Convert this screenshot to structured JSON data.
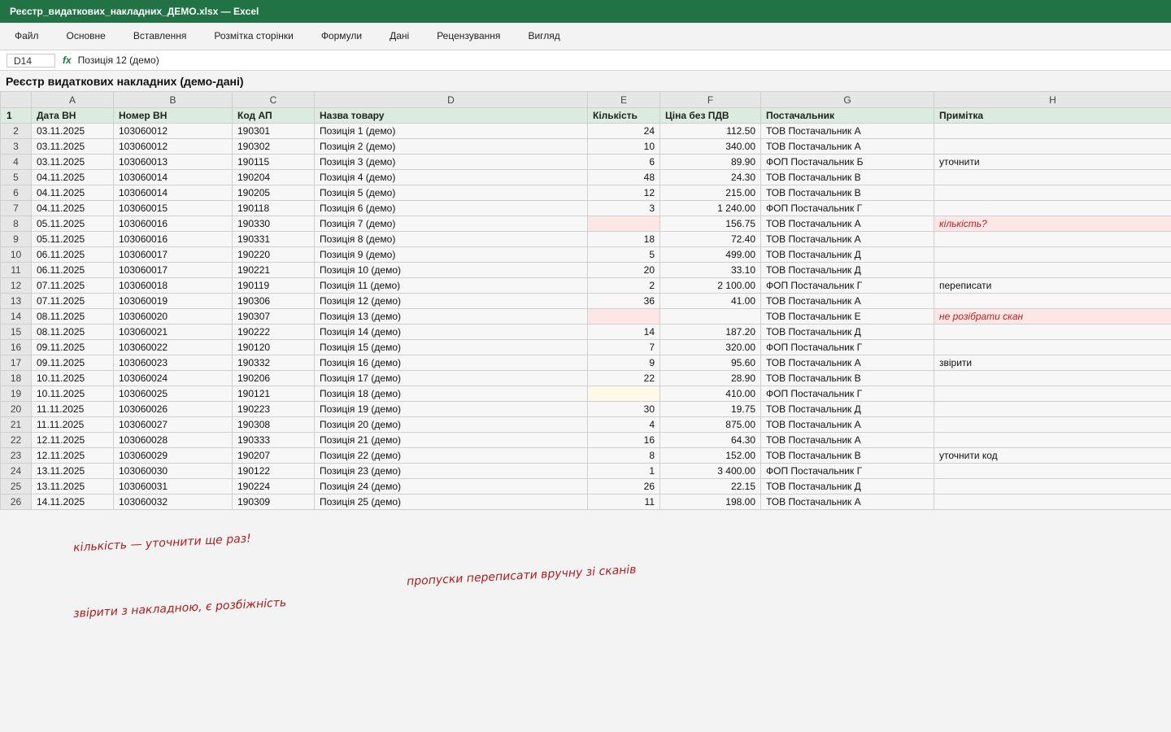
{
  "window": {
    "title": "Реєстр_видаткових_накладних_ДЕМО.xlsx — Excel"
  },
  "menu": [
    "Файл",
    "Основне",
    "Вставлення",
    "Розмітка сторінки",
    "Формули",
    "Дані",
    "Рецензування",
    "Вигляд"
  ],
  "formula_bar": {
    "cell_ref": "D14",
    "fx": "fx",
    "content": "Позиція 12 (демо)"
  },
  "sheet_title": "Реєстр видаткових накладних (демо-дані)",
  "columns": [
    "A",
    "B",
    "C",
    "D",
    "E",
    "F",
    "G",
    "H"
  ],
  "header": {
    "row_num": "1",
    "cells": [
      "Дата ВН",
      "Номер ВН",
      "Код АП",
      "Назва товару",
      "Кількість",
      "Ціна без ПДВ",
      "Постачальник",
      "Примітка"
    ]
  },
  "rows": [
    {
      "n": "2",
      "date": "03.11.2025",
      "doc": "103060012",
      "code": "190301",
      "name": "Позиція 1 (демо)",
      "qty": "24",
      "price": "112.50",
      "supplier": "ТОВ Постачальник А",
      "note": ""
    },
    {
      "n": "3",
      "date": "03.11.2025",
      "doc": "103060012",
      "code": "190302",
      "name": "Позиція 2 (демо)",
      "qty": "10",
      "price": "340.00",
      "supplier": "ТОВ Постачальник А",
      "note": ""
    },
    {
      "n": "4",
      "date": "03.11.2025",
      "doc": "103060013",
      "code": "190115",
      "name": "Позиція 3 (демо)",
      "qty": "6",
      "price": "89.90",
      "supplier": "ФОП Постачальник Б",
      "note": "уточнити"
    },
    {
      "n": "5",
      "date": "04.11.2025",
      "doc": "103060014",
      "code": "190204",
      "name": "Позиція 4 (демо)",
      "qty": "48",
      "price": "24.30",
      "supplier": "ТОВ Постачальник В",
      "note": ""
    },
    {
      "n": "6",
      "date": "04.11.2025",
      "doc": "103060014",
      "code": "190205",
      "name": "Позиція 5 (демо)",
      "qty": "12",
      "price": "215.00",
      "supplier": "ТОВ Постачальник В",
      "note": ""
    },
    {
      "n": "7",
      "date": "04.11.2025",
      "doc": "103060015",
      "code": "190118",
      "name": "Позиція 6 (демо)",
      "qty": "3",
      "price": "1 240.00",
      "supplier": "ФОП Постачальник Г",
      "note": ""
    },
    {
      "n": "8",
      "date": "05.11.2025",
      "doc": "103060016",
      "code": "190330",
      "name": "Позиція 7 (демо)",
      "qty": "",
      "price": "156.75",
      "supplier": "ТОВ Постачальник А",
      "note": "кількість?",
      "qty_flag": "missing",
      "note_flag": "alert"
    },
    {
      "n": "9",
      "date": "05.11.2025",
      "doc": "103060016",
      "code": "190331",
      "name": "Позиція 8 (демо)",
      "qty": "18",
      "price": "72.40",
      "supplier": "ТОВ Постачальник А",
      "note": ""
    },
    {
      "n": "10",
      "date": "06.11.2025",
      "doc": "103060017",
      "code": "190220",
      "name": "Позиція 9 (демо)",
      "qty": "5",
      "price": "499.00",
      "supplier": "ТОВ Постачальник Д",
      "note": ""
    },
    {
      "n": "11",
      "date": "06.11.2025",
      "doc": "103060017",
      "code": "190221",
      "name": "Позиція 10 (демо)",
      "qty": "20",
      "price": "33.10",
      "supplier": "ТОВ Постачальник Д",
      "note": ""
    },
    {
      "n": "12",
      "date": "07.11.2025",
      "doc": "103060018",
      "code": "190119",
      "name": "Позиція 11 (демо)",
      "qty": "2",
      "price": "2 100.00",
      "supplier": "ФОП Постачальник Г",
      "note": "переписати"
    },
    {
      "n": "13",
      "date": "07.11.2025",
      "doc": "103060019",
      "code": "190306",
      "name": "Позиція 12 (демо)",
      "qty": "36",
      "price": "41.00",
      "supplier": "ТОВ Постачальник А",
      "note": ""
    },
    {
      "n": "14",
      "date": "08.11.2025",
      "doc": "103060020",
      "code": "190307",
      "name": "Позиція 13 (демо)",
      "qty": "",
      "price": "",
      "supplier": "ТОВ Постачальник Е",
      "note": "не розібрати скан",
      "qty_flag": "missing",
      "note_flag": "alert"
    },
    {
      "n": "15",
      "date": "08.11.2025",
      "doc": "103060021",
      "code": "190222",
      "name": "Позиція 14 (демо)",
      "qty": "14",
      "price": "187.20",
      "supplier": "ТОВ Постачальник Д",
      "note": ""
    },
    {
      "n": "16",
      "date": "09.11.2025",
      "doc": "103060022",
      "code": "190120",
      "name": "Позиція 15 (демо)",
      "qty": "7",
      "price": "320.00",
      "supplier": "ФОП Постачальник Г",
      "note": ""
    },
    {
      "n": "17",
      "date": "09.11.2025",
      "doc": "103060023",
      "code": "190332",
      "name": "Позиція 16 (демо)",
      "qty": "9",
      "price": "95.60",
      "supplier": "ТОВ Постачальник А",
      "note": "звірити"
    },
    {
      "n": "18",
      "date": "10.11.2025",
      "doc": "103060024",
      "code": "190206",
      "name": "Позиція 17 (демо)",
      "qty": "22",
      "price": "28.90",
      "supplier": "ТОВ Постачальник В",
      "note": ""
    },
    {
      "n": "19",
      "date": "10.11.2025",
      "doc": "103060025",
      "code": "190121",
      "name": "Позиція 18 (демо)",
      "qty": "",
      "price": "410.00",
      "supplier": "ФОП Постачальник Г",
      "note": "",
      "qty_flag": "pale"
    },
    {
      "n": "20",
      "date": "11.11.2025",
      "doc": "103060026",
      "code": "190223",
      "name": "Позиція 19 (демо)",
      "qty": "30",
      "price": "19.75",
      "supplier": "ТОВ Постачальник Д",
      "note": ""
    },
    {
      "n": "21",
      "date": "11.11.2025",
      "doc": "103060027",
      "code": "190308",
      "name": "Позиція 20 (демо)",
      "qty": "4",
      "price": "875.00",
      "supplier": "ТОВ Постачальник А",
      "note": ""
    },
    {
      "n": "22",
      "date": "12.11.2025",
      "doc": "103060028",
      "code": "190333",
      "name": "Позиція 21 (демо)",
      "qty": "16",
      "price": "64.30",
      "supplier": "ТОВ Постачальник А",
      "note": ""
    },
    {
      "n": "23",
      "date": "12.11.2025",
      "doc": "103060029",
      "code": "190207",
      "name": "Позиція 22 (демо)",
      "qty": "8",
      "price": "152.00",
      "supplier": "ТОВ Постачальник В",
      "note": "уточнити код"
    },
    {
      "n": "24",
      "date": "13.11.2025",
      "doc": "103060030",
      "code": "190122",
      "name": "Позиція 23 (демо)",
      "qty": "1",
      "price": "3 400.00",
      "supplier": "ФОП Постачальник Г",
      "note": ""
    },
    {
      "n": "25",
      "date": "13.11.2025",
      "doc": "103060031",
      "code": "190224",
      "name": "Позиція 24 (демо)",
      "qty": "26",
      "price": "22.15",
      "supplier": "ТОВ Постачальник Д",
      "note": ""
    },
    {
      "n": "26",
      "date": "14.11.2025",
      "doc": "103060032",
      "code": "190309",
      "name": "Позиція 25 (демо)",
      "qty": "11",
      "price": "198.00",
      "supplier": "ТОВ Постачальник А",
      "note": ""
    }
  ],
  "handwritten_notes": [
    "кількість — уточнити ще раз!",
    "пропуски переписати вручну зі сканів",
    "звірити з накладною, є розбіжність"
  ]
}
